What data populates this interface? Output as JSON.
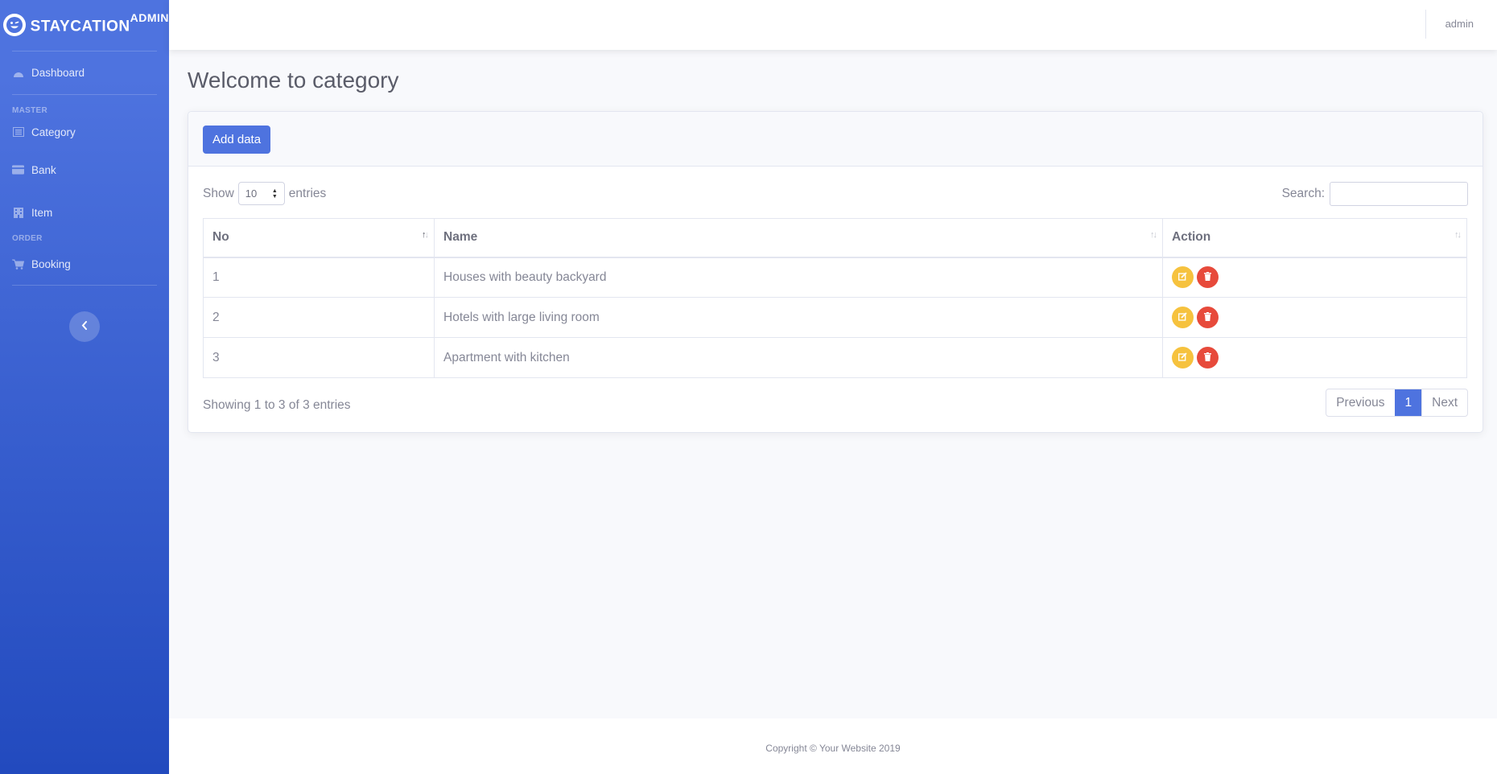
{
  "sidebar": {
    "brand": {
      "name": "STAYCATION",
      "suffix": "ADMIN"
    },
    "dashboard_label": "Dashboard",
    "heading_master": "MASTER",
    "category_label": "Category",
    "bank_label": "Bank",
    "item_label": "Item",
    "heading_order": "ORDER",
    "booking_label": "Booking"
  },
  "topbar": {
    "user": "admin"
  },
  "page": {
    "title": "Welcome to category"
  },
  "card": {
    "add_label": "Add data"
  },
  "table_controls": {
    "show_label": "Show",
    "entries_value": "10",
    "entries_label": "entries",
    "search_label": "Search:"
  },
  "table": {
    "headers": [
      "No",
      "Name",
      "Action"
    ],
    "rows": [
      {
        "no": "1",
        "name": "Houses with beauty backyard"
      },
      {
        "no": "2",
        "name": "Hotels with large living room"
      },
      {
        "no": "3",
        "name": "Apartment with kitchen"
      }
    ]
  },
  "pagination": {
    "info": "Showing 1 to 3 of 3 entries",
    "previous": "Previous",
    "current": "1",
    "next": "Next"
  },
  "footer": {
    "text": "Copyright © Your Website 2019"
  },
  "colors": {
    "primary": "#4e73df",
    "warning": "#f6c23e",
    "danger": "#e74a3b"
  }
}
